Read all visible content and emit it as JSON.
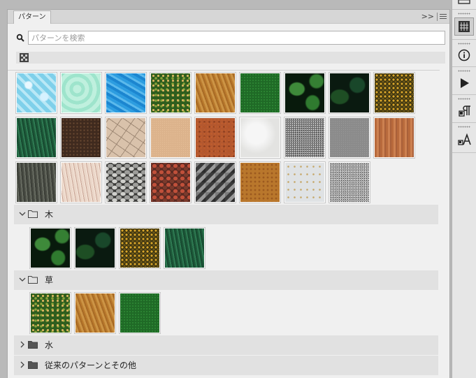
{
  "panel": {
    "tab_label": "パターン",
    "collapse_glyph": ">>",
    "search": {
      "placeholder": "パターンを検索",
      "value": ""
    }
  },
  "swatch_icons": {
    "rows": [
      [
        "water-caustics-cyan",
        "water-caustics-mint",
        "water-blue",
        "grass-yellow-green",
        "grass-dry-brown",
        "grass-green",
        "leaves-dark-green",
        "leaves-dark",
        "foliage-yellow"
      ],
      [
        "tree-bark-green",
        "soil-brown",
        "cracked-clay",
        "sand-beige",
        "rust-orange",
        "plaster-white",
        "gravel-gray",
        "concrete-gray",
        "wood-grain"
      ],
      [
        "bark-gray",
        "wood-pale",
        "pebbles-gray",
        "stones-red",
        "rocks-dark",
        "rust-metal",
        "wall-white",
        "granite-gray"
      ]
    ]
  },
  "groups": [
    {
      "label": "木",
      "expanded": true,
      "swatches": [
        "leaves-dark-green",
        "leaves-dark",
        "foliage-yellow",
        "tree-bark-green"
      ]
    },
    {
      "label": "草",
      "expanded": true,
      "swatches": [
        "grass-yellow-green",
        "grass-dry-brown",
        "grass-green"
      ]
    },
    {
      "label": "水",
      "expanded": false,
      "swatches": []
    },
    {
      "label": "従来のパターンとその他",
      "expanded": false,
      "swatches": []
    }
  ],
  "dock": {
    "buttons": [
      "panel-icon",
      "pattern-panel-icon",
      "info-icon",
      "play-icon",
      "paragraph-style-icon",
      "character-style-icon"
    ],
    "active": "pattern-panel-icon"
  },
  "colors": {
    "panel_bg": "#f0f0f0",
    "header_bg": "#e1e1e1",
    "dock_bg": "#e6e6e6"
  }
}
